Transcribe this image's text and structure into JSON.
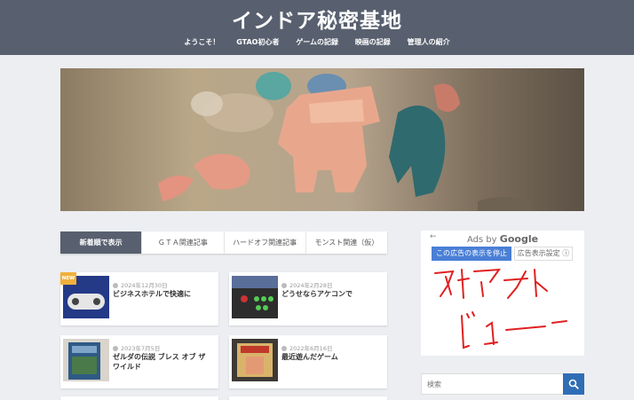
{
  "header": {
    "site_title": "インドア秘密基地",
    "nav": [
      "ようこそ！",
      "GTAO初心者",
      "ゲームの記録",
      "映画の記録",
      "管理人の紹介"
    ]
  },
  "tabs": [
    "新着順で表示",
    "ＧＴＡ関連記事",
    "ハードオフ関連記事",
    "モンスト関連（仮）"
  ],
  "posts": [
    {
      "date": "2024年12月30日",
      "title": "ビジネスホテルで快適に",
      "badge": "NEW"
    },
    {
      "date": "2024年2月28日",
      "title": "どうせならアケコンで"
    },
    {
      "date": "2023年7月5日",
      "title": "ゼルダの伝説 ブレス オブ ザ ワイルド"
    },
    {
      "date": "2022年6月16日",
      "title": "最近遊んだゲーム"
    }
  ],
  "ad": {
    "back": "←",
    "ads_by_prefix": "Ads by",
    "google": "Google",
    "stop_label": "この広告の表示を停止",
    "settings_label": "広告表示設定 ⓘ"
  },
  "search": {
    "placeholder": "検索"
  }
}
